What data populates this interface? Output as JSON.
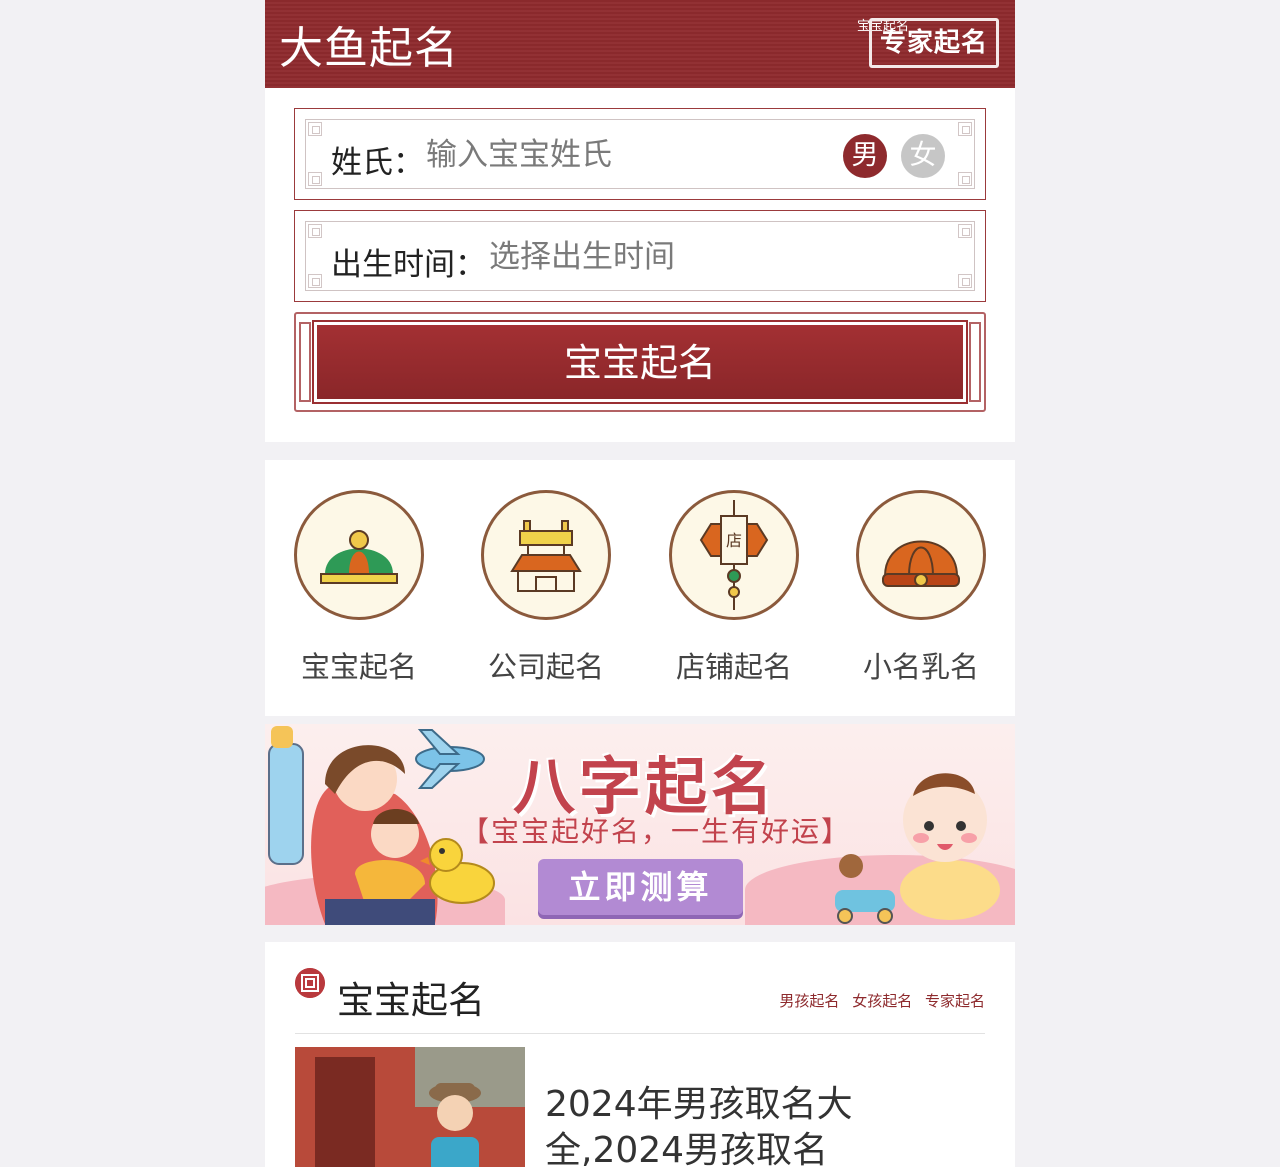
{
  "header": {
    "logo_text": "大鱼起名",
    "small_link": "宝宝起名",
    "expert_label": "专家起名"
  },
  "form": {
    "surname_label": "姓氏：",
    "surname_placeholder": "输入宝宝姓氏",
    "gender_male": "男",
    "gender_female": "女",
    "birth_label": "出生时间：",
    "birth_placeholder": "选择出生时间",
    "submit_label": "宝宝起名"
  },
  "categories": [
    {
      "label": "宝宝起名",
      "icon": "baby-hat-icon"
    },
    {
      "label": "公司起名",
      "icon": "building-icon"
    },
    {
      "label": "店铺起名",
      "icon": "shop-sign-icon"
    },
    {
      "label": "小名乳名",
      "icon": "cap-icon"
    }
  ],
  "banner": {
    "title": "八字起名",
    "subtitle": "【宝宝起好名，一生有好运】",
    "button": "立即测算"
  },
  "section": {
    "title": "宝宝起名",
    "links": [
      "男孩起名",
      "女孩起名",
      "专家起名"
    ]
  },
  "article": {
    "title": "2024年男孩取名大全,2024男孩取名"
  },
  "colors": {
    "brand": "#8e2a2d",
    "female_inactive": "#c6c6c6",
    "banner_button": "#b28ad3"
  }
}
